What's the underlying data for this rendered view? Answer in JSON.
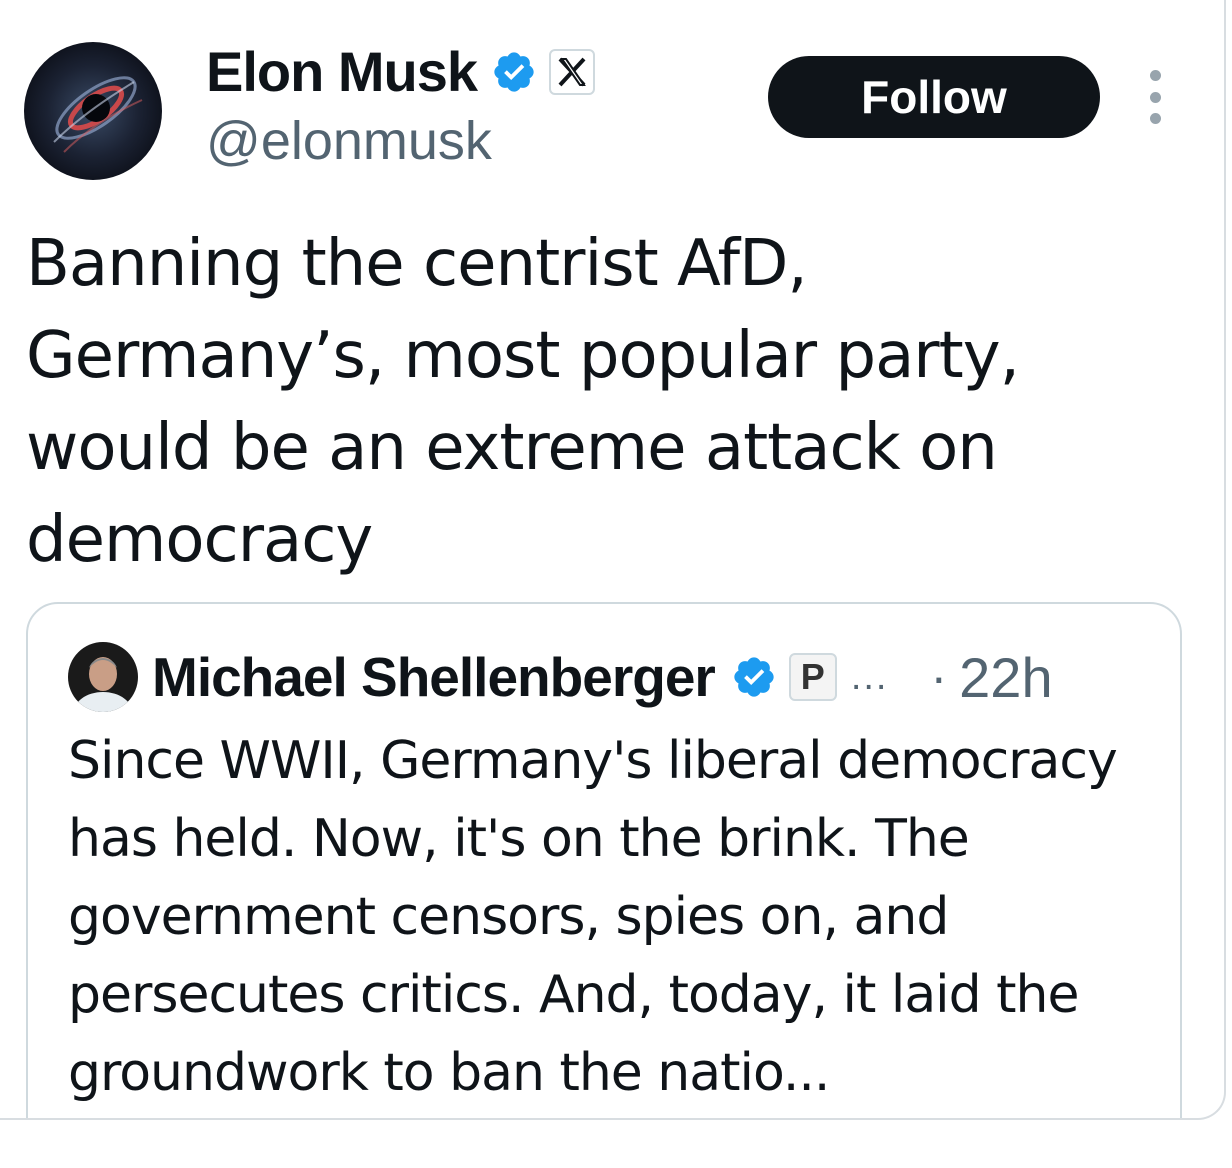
{
  "author": {
    "display_name": "Elon Musk",
    "handle": "@elonmusk",
    "verified_icon": "verified-badge-icon",
    "affiliation_icon": "x-logo-icon"
  },
  "actions": {
    "follow_label": "Follow",
    "more_icon": "more-vertical-icon"
  },
  "tweet": {
    "text": "Banning the centrist AfD, Germany’s, most popular party, would be an extreme attack on democracy"
  },
  "quoted_tweet": {
    "display_name": "Michael Shellenberger",
    "verified_icon": "verified-badge-icon",
    "affiliation_label": "P",
    "truncation": "...",
    "separator": "·",
    "time": "22h",
    "text": "Since WWII, Germany's liberal democracy has held. Now, it's on the brink. The government censors, spies on, and persecutes critics. And, today, it laid the groundwork to ban the natio..."
  },
  "colors": {
    "text": "#0f1419",
    "secondary": "#536471",
    "verified": "#1d9bf0",
    "border": "#cfd9de",
    "button_bg": "#0f1419",
    "button_text": "#ffffff"
  }
}
